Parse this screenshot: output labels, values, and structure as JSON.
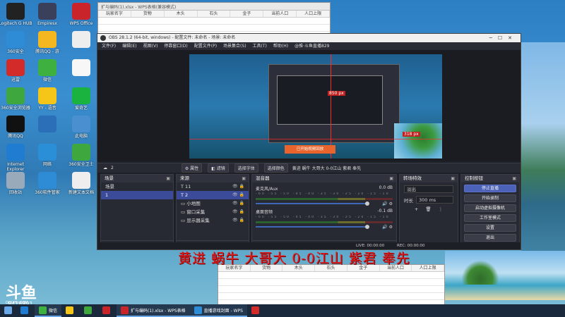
{
  "desktop_icons": [
    {
      "label": "Logitech G HUB",
      "color": "#222"
    },
    {
      "label": "Empiresx",
      "color": "#3a3f5a"
    },
    {
      "label": "WPS Office",
      "color": "#c8242a"
    },
    {
      "label": "360安全",
      "color": "#2e8bd6"
    },
    {
      "label": "腾讯QQ - 游",
      "color": "#f4b71f"
    },
    {
      "label": "",
      "color": "#eee"
    },
    {
      "label": "迅雷",
      "color": "#d32a2a"
    },
    {
      "label": "微信",
      "color": "#3eb040"
    },
    {
      "label": "",
      "color": "#f7f7f7"
    },
    {
      "label": "360安全浏览器",
      "color": "#3ea83e"
    },
    {
      "label": "YY - 语音",
      "color": "#f5c518"
    },
    {
      "label": "爱奇艺",
      "color": "#1bb33f"
    },
    {
      "label": "腾讯QQ",
      "color": "#111"
    },
    {
      "label": "",
      "color": "#2a6fb8"
    },
    {
      "label": "此电脑",
      "color": "#4a8fd0"
    },
    {
      "label": "Internet Explorer",
      "color": "#1f7cd0"
    },
    {
      "label": "网络",
      "color": "#2a8fd6"
    },
    {
      "label": "360安全卫士",
      "color": "#3ea83e"
    },
    {
      "label": "回收站",
      "color": "#9ab"
    },
    {
      "label": "360软件管家",
      "color": "#2e8bd6"
    },
    {
      "label": "新建文本文档",
      "color": "#eee"
    }
  ],
  "top_sheet": {
    "title": "扩与编码(1).xlsx - WPS表格(兼容模式)",
    "columns": [
      "玩家名字",
      "货物",
      "木头",
      "石头",
      "金子",
      "当前人口",
      "人口上限"
    ]
  },
  "bottom_sheet": {
    "columns": [
      "玩家名字",
      "货物",
      "木头",
      "石头",
      "金子",
      "当前人口",
      "人口上限"
    ]
  },
  "obs": {
    "title": "OBS 28.1.2 (64-bit, windows) - 配置文件: 未命名 - 场景: 未命名",
    "menu": [
      "文件(F)",
      "编辑(E)",
      "视图(V)",
      "停靠窗口(D)",
      "配置文件(P)",
      "场景集合(S)",
      "工具(T)",
      "帮助(H)",
      "@推·斗鱼直播829"
    ],
    "preview": {
      "px_label_1": "850 px",
      "px_label_2": "318 px",
      "toast": "已开始视频回放"
    },
    "source_bar": {
      "count": "2",
      "properties": "属性",
      "filters": "滤镜",
      "choose_font": "选择字体",
      "choose_color": "选择颜色",
      "text": "黄进 蜗牛 大哥大 0-0江山 紫君 奉先"
    },
    "scenes": {
      "header": "场景",
      "items": [
        "场景",
        "1"
      ]
    },
    "sources": {
      "header": "来源",
      "items": [
        "11",
        "2",
        "小地图",
        "窗口采集",
        "显示器采集"
      ]
    },
    "mixer": {
      "header": "混音器",
      "channels": [
        {
          "name": "麦克风/Aux",
          "db": "0.0 dB"
        },
        {
          "name": "桌面音频",
          "db": "-0.1 dB"
        }
      ],
      "ticks": "-60 -55 -50 -45 -40 -35 -30 -25 -20 -15 -10 -5 0"
    },
    "transitions": {
      "header": "转场特效",
      "type": "淡出",
      "duration_label": "时长",
      "duration": "300 ms"
    },
    "controls": {
      "header": "控制按钮",
      "buttons": [
        "停止直播",
        "开始录制",
        "启动虚拟摄像机",
        "工作室模式",
        "设置",
        "退出"
      ]
    },
    "status": {
      "live": "LIVE: 00:00:00",
      "rec": "REC: 00:00:00"
    }
  },
  "caption": "黄进 蜗牛 大哥大 0-0江山 紫君 奉先",
  "watermark": {
    "brand": "斗鱼",
    "sub": "DOUYU.COM",
    "room": "9418991"
  },
  "taskbar": [
    {
      "label": "",
      "color": "#1f7cd0",
      "open": false
    },
    {
      "label": "微信",
      "color": "#3eb040",
      "open": true
    },
    {
      "label": "",
      "color": "#f5c518",
      "open": false
    },
    {
      "label": "",
      "color": "#3ea83e",
      "open": false
    },
    {
      "label": "",
      "color": "#c8242a",
      "open": false
    },
    {
      "label": "扩与编码(1).xlsx - WPS表格",
      "color": "#c8242a",
      "open": true
    },
    {
      "label": "直播游戏封面 - WPS",
      "color": "#2e8bd6",
      "open": true
    },
    {
      "label": "",
      "color": "#d32a2a",
      "open": false
    }
  ]
}
